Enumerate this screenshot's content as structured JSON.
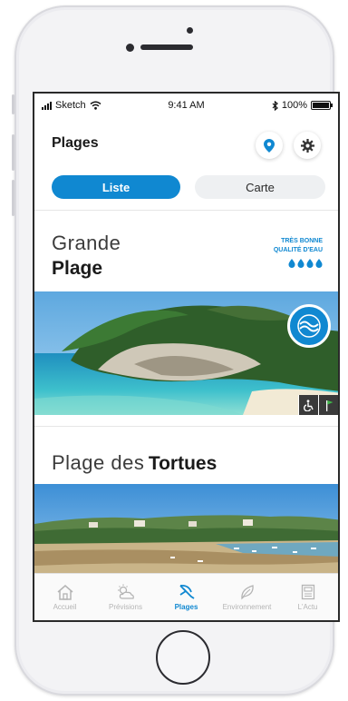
{
  "status_bar": {
    "carrier": "Sketch",
    "time": "9:41 AM",
    "battery_text": "100%",
    "battery_level": 1.0
  },
  "header": {
    "title": "Plages",
    "map_pin_icon": "location-pin-icon",
    "settings_icon": "gear-icon"
  },
  "view_toggle": {
    "list_label": "Liste",
    "map_label": "Carte",
    "selected": "Liste"
  },
  "beaches": [
    {
      "name_light": "Grande",
      "name_bold": "Plage",
      "quality_line1": "TRÈS BONNE",
      "quality_line2": "QUALITÉ D'EAU",
      "quality_drops": 4,
      "quality_badge_icon": "wave-icon",
      "facility_icons": [
        "wheelchair-icon",
        "flag-icon"
      ]
    },
    {
      "name_light": "Plage des",
      "name_bold": "Tortues"
    }
  ],
  "tab_bar": {
    "tabs": [
      {
        "label": "Accueil",
        "icon": "home-icon"
      },
      {
        "label": "Prévisions",
        "icon": "weather-icon"
      },
      {
        "label": "Plages",
        "icon": "beach-icon",
        "active": true
      },
      {
        "label": "Environnement",
        "icon": "leaf-icon"
      },
      {
        "label": "L'Actu",
        "icon": "news-icon"
      }
    ]
  },
  "colors": {
    "accent": "#1088d1",
    "segment_inactive": "#eef0f2",
    "text_dark": "#1a1a1a",
    "tab_inactive": "#b4b4b4"
  }
}
